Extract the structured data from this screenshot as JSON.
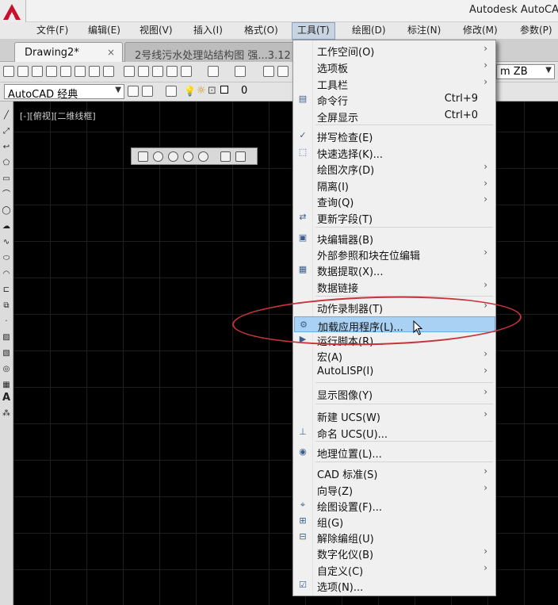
{
  "app": {
    "title": "Autodesk AutoCA"
  },
  "menubar": [
    {
      "label": "文件(F)"
    },
    {
      "label": "编辑(E)"
    },
    {
      "label": "视图(V)"
    },
    {
      "label": "插入(I)"
    },
    {
      "label": "格式(O)"
    },
    {
      "label": "工具(T)"
    },
    {
      "label": "绘图(D)"
    },
    {
      "label": "标注(N)"
    },
    {
      "label": "修改(M)"
    },
    {
      "label": "参数(P)"
    }
  ],
  "tabs": [
    {
      "label": "Drawing2*",
      "close": "×"
    },
    {
      "label": "2号线污水处理站结构图 强...3.12"
    }
  ],
  "toolbar": {
    "workspace": "AutoCAD 经典",
    "layer": "0",
    "linetype": "m ZB"
  },
  "viewport": {
    "label": "[-][俯视][二维线框]"
  },
  "dropdown": {
    "items": [
      {
        "label": "工作空间(O)",
        "submenu": true
      },
      {
        "label": "选项板",
        "submenu": true
      },
      {
        "label": "工具栏",
        "submenu": true
      },
      {
        "label": "命令行",
        "shortcut": "Ctrl+9",
        "icon": "command-line-icon",
        "glyph": "▤"
      },
      {
        "label": "全屏显示",
        "shortcut": "Ctrl+0"
      },
      {
        "label": "拼写检查(E)",
        "icon": "spell-check-icon",
        "glyph": "✓"
      },
      {
        "label": "快速选择(K)...",
        "icon": "quick-select-icon",
        "glyph": "⬚"
      },
      {
        "label": "绘图次序(D)",
        "submenu": true
      },
      {
        "label": "隔离(I)",
        "submenu": true
      },
      {
        "label": "查询(Q)",
        "submenu": true
      },
      {
        "label": "更新字段(T)",
        "icon": "update-field-icon",
        "glyph": "⇄"
      },
      {
        "label": "块编辑器(B)",
        "icon": "block-editor-icon",
        "glyph": "▣"
      },
      {
        "label": "外部参照和块在位编辑",
        "submenu": true
      },
      {
        "label": "数据提取(X)...",
        "icon": "data-extraction-icon",
        "glyph": "▦"
      },
      {
        "label": "数据链接",
        "submenu": true
      },
      {
        "label": "动作录制器(T)",
        "submenu": true
      },
      {
        "label": "加载应用程序(L)...",
        "icon": "load-application-icon",
        "glyph": "⚙",
        "highlighted": true
      },
      {
        "label": "运行脚本(R)...",
        "icon": "run-script-icon",
        "glyph": "▶"
      },
      {
        "label": "宏(A)",
        "submenu": true
      },
      {
        "label": "AutoLISP(I)",
        "submenu": true
      },
      {
        "label": "显示图像(Y)",
        "submenu": true
      },
      {
        "label": "新建 UCS(W)",
        "submenu": true
      },
      {
        "label": "命名 UCS(U)...",
        "icon": "named-ucs-icon",
        "glyph": "⊥"
      },
      {
        "label": "地理位置(L)...",
        "icon": "geolocation-icon",
        "glyph": "◉"
      },
      {
        "label": "CAD 标准(S)",
        "submenu": true
      },
      {
        "label": "向导(Z)",
        "submenu": true
      },
      {
        "label": "绘图设置(F)...",
        "icon": "drafting-settings-icon",
        "glyph": "⌖"
      },
      {
        "label": "组(G)",
        "icon": "group-icon",
        "glyph": "⊞"
      },
      {
        "label": "解除编组(U)",
        "icon": "ungroup-icon",
        "glyph": "⊟"
      },
      {
        "label": "数字化仪(B)",
        "submenu": true
      },
      {
        "label": "自定义(C)",
        "submenu": true
      },
      {
        "label": "选项(N)...",
        "icon": "options-icon",
        "glyph": "☑"
      }
    ]
  }
}
